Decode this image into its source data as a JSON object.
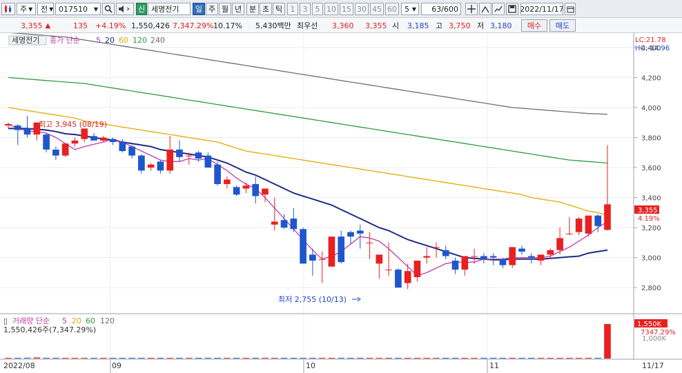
{
  "toolbar": {
    "timeframe": "주",
    "market": "전",
    "code": "017510",
    "name": "세명전기",
    "new_badge": "신",
    "periods": [
      "일",
      "주",
      "월",
      "년",
      "분",
      "초",
      "틱"
    ],
    "intervals": [
      "1",
      "3",
      "5",
      "10",
      "15",
      "30",
      "45",
      "60"
    ],
    "tick_count": "5",
    "count_display": "63/600",
    "date": "2022/11/17"
  },
  "quote": {
    "price": "3,355",
    "change": "135",
    "change_pct": "+4.19%",
    "volume": "1,550,426",
    "vol_ratio": "7,347.29%",
    "turnover": "10.17%",
    "amount": "5,430백만",
    "pref_label": "최우선",
    "best_ask": "3,360",
    "best_bid": "3,355",
    "open_label": "시",
    "open": "3,185",
    "high_label": "고",
    "high": "3,750",
    "low_label": "저",
    "low": "3,180",
    "buy": "매수",
    "sell": "매도"
  },
  "price_panel": {
    "stock_tag": "세명전기",
    "ma_title": "종가 단순",
    "ma_labels": [
      "5",
      "20",
      "60",
      "120",
      "240"
    ],
    "lc": "LC:21.78",
    "hc": "HC:-14.96",
    "max_annotation": "최고 3,945 (08/19)",
    "min_annotation": "최저 2,755 (10/13)",
    "last_price_tag": "3,355",
    "last_pct_tag": "4.19%",
    "y_ticks": [
      "4,400",
      "4,200",
      "4,000",
      "3,800",
      "3,600",
      "3,400",
      "3,200",
      "3,000",
      "2,800"
    ]
  },
  "volume_panel": {
    "title": "거래량 단순",
    "ma_labels": [
      "5",
      "20",
      "60",
      "120"
    ],
    "info": "1,550,426주(7,347.29%)",
    "last_tag": "1,550K",
    "last_pct_tag": "7347.29%",
    "y_tick": "1,000K"
  },
  "x_labels": [
    "2022/08",
    "09",
    "10",
    "11",
    "11/17"
  ],
  "colors": {
    "up": "#e8201f",
    "down": "#1f56cc",
    "ma5": "#c03caa",
    "ma20": "#1d2a86",
    "ma60": "#e8a800",
    "ma120": "#2f9a3f",
    "ma240": "#6f6f6f"
  },
  "chart_data": {
    "type": "candlestick",
    "ylim": [
      2640,
      4450
    ],
    "dates": [
      "08/16",
      "08/17",
      "08/18",
      "08/19",
      "08/22",
      "08/23",
      "08/24",
      "08/25",
      "08/26",
      "08/29",
      "08/30",
      "08/31",
      "09/01",
      "09/02",
      "09/05",
      "09/06",
      "09/07",
      "09/08",
      "09/13",
      "09/14",
      "09/15",
      "09/16",
      "09/19",
      "09/20",
      "09/21",
      "09/22",
      "09/23",
      "09/26",
      "09/27",
      "09/28",
      "09/29",
      "09/30",
      "10/04",
      "10/05",
      "10/06",
      "10/07",
      "10/11",
      "10/12",
      "10/13",
      "10/14",
      "10/17",
      "10/18",
      "10/19",
      "10/20",
      "10/21",
      "10/24",
      "10/25",
      "10/26",
      "10/27",
      "10/28",
      "10/31",
      "11/01",
      "11/02",
      "11/03",
      "11/04",
      "11/07",
      "11/08",
      "11/09",
      "11/10",
      "11/11",
      "11/14",
      "11/15",
      "11/16",
      "11/17"
    ],
    "candles": [
      [
        3880,
        3900,
        3860,
        3890
      ],
      [
        3880,
        3890,
        3750,
        3850
      ],
      [
        3860,
        3945,
        3800,
        3820
      ],
      [
        3820,
        3900,
        3780,
        3900
      ],
      [
        3820,
        3830,
        3700,
        3720
      ],
      [
        3720,
        3740,
        3650,
        3680
      ],
      [
        3680,
        3760,
        3670,
        3760
      ],
      [
        3760,
        3800,
        3740,
        3780
      ],
      [
        3790,
        3860,
        3770,
        3860
      ],
      [
        3810,
        3830,
        3780,
        3780
      ],
      [
        3780,
        3810,
        3770,
        3800
      ],
      [
        3790,
        3800,
        3750,
        3770
      ],
      [
        3770,
        3790,
        3700,
        3710
      ],
      [
        3740,
        3750,
        3660,
        3680
      ],
      [
        3680,
        3690,
        3560,
        3580
      ],
      [
        3600,
        3630,
        3580,
        3620
      ],
      [
        3640,
        3650,
        3560,
        3580
      ],
      [
        3580,
        3810,
        3560,
        3720
      ],
      [
        3720,
        3780,
        3640,
        3670
      ],
      [
        3680,
        3700,
        3620,
        3680
      ],
      [
        3700,
        3710,
        3640,
        3660
      ],
      [
        3680,
        3700,
        3610,
        3600
      ],
      [
        3620,
        3640,
        3480,
        3490
      ],
      [
        3490,
        3540,
        3460,
        3520
      ],
      [
        3470,
        3480,
        3410,
        3420
      ],
      [
        3460,
        3500,
        3430,
        3480
      ],
      [
        3490,
        3540,
        3360,
        3410
      ],
      [
        3420,
        3460,
        3370,
        3460
      ],
      [
        3220,
        3400,
        3180,
        3240
      ],
      [
        3250,
        3290,
        3190,
        3200
      ],
      [
        3260,
        3330,
        3170,
        3190
      ],
      [
        3190,
        3200,
        2960,
        2960
      ],
      [
        3020,
        3060,
        2880,
        2980
      ],
      [
        2990,
        3040,
        2830,
        2990
      ],
      [
        2940,
        3130,
        2940,
        3140
      ],
      [
        3140,
        3180,
        2960,
        2970
      ],
      [
        3170,
        3180,
        3090,
        3140
      ],
      [
        3180,
        3220,
        3060,
        3160
      ],
      [
        3100,
        3170,
        2990,
        3100
      ],
      [
        2960,
        3020,
        2860,
        3020
      ],
      [
        2920,
        3100,
        2880,
        2920
      ],
      [
        2920,
        2930,
        2830,
        2800
      ],
      [
        2830,
        2960,
        2790,
        2910
      ],
      [
        2870,
        2960,
        2840,
        2980
      ],
      [
        3000,
        3070,
        2960,
        3010
      ],
      [
        3070,
        3100,
        3000,
        3070
      ],
      [
        3050,
        3080,
        2990,
        3010
      ],
      [
        2980,
        3000,
        2890,
        2920
      ],
      [
        2920,
        3010,
        2880,
        3010
      ],
      [
        3010,
        3060,
        2960,
        3010
      ],
      [
        3010,
        3030,
        2960,
        2990
      ],
      [
        3010,
        3030,
        2950,
        3000
      ],
      [
        2990,
        3000,
        2930,
        2950
      ],
      [
        2950,
        3070,
        2930,
        3070
      ],
      [
        3060,
        3080,
        3020,
        3040
      ],
      [
        3010,
        3030,
        2960,
        3000
      ],
      [
        2980,
        3020,
        2950,
        3020
      ],
      [
        3020,
        3060,
        2990,
        3050
      ],
      [
        3050,
        3200,
        3020,
        3130
      ],
      [
        3160,
        3270,
        3150,
        3160
      ],
      [
        3170,
        3270,
        3150,
        3260
      ],
      [
        3160,
        3280,
        3140,
        3280
      ],
      [
        3280,
        3290,
        3170,
        3210
      ],
      [
        3185,
        3750,
        3180,
        3355
      ]
    ],
    "ma5": [
      3890,
      3860,
      3845,
      3840,
      3830,
      3800,
      3760,
      3720,
      3740,
      3755,
      3770,
      3790,
      3770,
      3740,
      3710,
      3680,
      3650,
      3640,
      3640,
      3660,
      3650,
      3660,
      3620,
      3580,
      3530,
      3490,
      3460,
      3400,
      3330,
      3260,
      3190,
      3120,
      3050,
      2990,
      3010,
      3040,
      3090,
      3140,
      3130,
      3110,
      3060,
      3000,
      2940,
      2880,
      2900,
      2930,
      2960,
      2970,
      2970,
      2970,
      2990,
      2990,
      2990,
      3000,
      3000,
      3000,
      3000,
      3010,
      3040,
      3070,
      3110,
      3150,
      3200,
      3240
    ],
    "ma20": [
      3860,
      3860,
      3860,
      3855,
      3850,
      3840,
      3825,
      3820,
      3810,
      3800,
      3790,
      3785,
      3770,
      3760,
      3750,
      3740,
      3720,
      3710,
      3700,
      3690,
      3680,
      3670,
      3650,
      3630,
      3600,
      3570,
      3550,
      3520,
      3490,
      3460,
      3430,
      3410,
      3390,
      3370,
      3350,
      3320,
      3290,
      3260,
      3230,
      3200,
      3180,
      3150,
      3120,
      3100,
      3080,
      3060,
      3040,
      3020,
      3000,
      2995,
      2990,
      2985,
      2985,
      2990,
      2990,
      2990,
      2990,
      2995,
      3000,
      3005,
      3010,
      3030,
      3040,
      3050
    ],
    "ma60": [
      4000,
      3990,
      3980,
      3970,
      3960,
      3950,
      3940,
      3930,
      3910,
      3900,
      3890,
      3880,
      3870,
      3860,
      3850,
      3840,
      3830,
      3820,
      3810,
      3800,
      3790,
      3780,
      3770,
      3750,
      3730,
      3710,
      3700,
      3690,
      3680,
      3670,
      3660,
      3650,
      3640,
      3630,
      3620,
      3610,
      3600,
      3590,
      3580,
      3570,
      3560,
      3550,
      3540,
      3530,
      3520,
      3510,
      3500,
      3490,
      3480,
      3470,
      3460,
      3450,
      3440,
      3430,
      3420,
      3400,
      3390,
      3380,
      3370,
      3350,
      3330,
      3310,
      3300,
      3280
    ],
    "ma120": [
      4200,
      4195,
      4190,
      4185,
      4180,
      4175,
      4170,
      4165,
      4160,
      4150,
      4140,
      4130,
      4120,
      4110,
      4100,
      4090,
      4080,
      4070,
      4060,
      4050,
      4040,
      4030,
      4020,
      4010,
      4000,
      3990,
      3980,
      3970,
      3960,
      3950,
      3940,
      3930,
      3920,
      3910,
      3900,
      3890,
      3880,
      3870,
      3860,
      3850,
      3840,
      3830,
      3820,
      3810,
      3800,
      3790,
      3780,
      3770,
      3760,
      3750,
      3740,
      3730,
      3720,
      3710,
      3700,
      3690,
      3680,
      3670,
      3660,
      3650,
      3645,
      3640,
      3635,
      3630
    ],
    "ma240": [
      4500,
      4495,
      4490,
      4485,
      4480,
      4475,
      4470,
      4460,
      4450,
      4440,
      4430,
      4420,
      4410,
      4400,
      4390,
      4380,
      4370,
      4360,
      4350,
      4340,
      4330,
      4320,
      4310,
      4300,
      4290,
      4280,
      4270,
      4260,
      4250,
      4240,
      4230,
      4220,
      4210,
      4200,
      4190,
      4180,
      4170,
      4160,
      4150,
      4140,
      4130,
      4120,
      4110,
      4100,
      4090,
      4080,
      4070,
      4060,
      4050,
      4040,
      4030,
      4020,
      4010,
      4000,
      3995,
      3990,
      3985,
      3980,
      3975,
      3970,
      3965,
      3960,
      3958,
      3955
    ],
    "volume": [
      22,
      20,
      35,
      45,
      18,
      16,
      15,
      14,
      18,
      12,
      12,
      10,
      14,
      12,
      18,
      10,
      12,
      30,
      14,
      12,
      10,
      12,
      20,
      14,
      16,
      12,
      14,
      12,
      30,
      20,
      18,
      28,
      24,
      20,
      26,
      16,
      14,
      14,
      16,
      18,
      20,
      22,
      18,
      16,
      14,
      12,
      14,
      16,
      12,
      12,
      10,
      12,
      14,
      18,
      12,
      10,
      12,
      14,
      30,
      24,
      20,
      26,
      18,
      1550
    ]
  }
}
